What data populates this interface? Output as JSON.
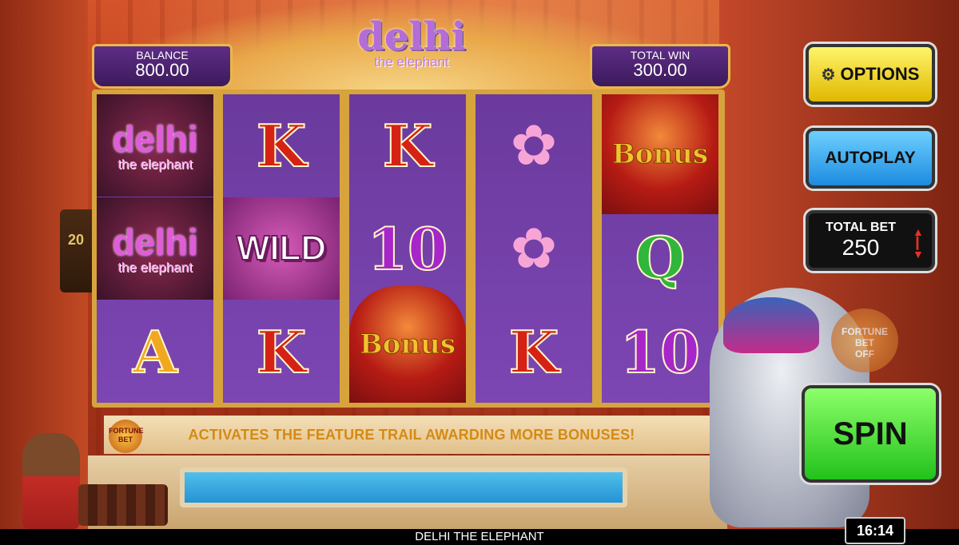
{
  "meters": {
    "balance": {
      "label": "BALANCE",
      "value": "800.00"
    },
    "total_win": {
      "label": "TOTAL WIN",
      "value": "300.00"
    }
  },
  "logo": {
    "line1": "delhi",
    "line2": "the elephant"
  },
  "reels": [
    [
      "delhi",
      "delhi",
      "A"
    ],
    [
      "K",
      "WILD",
      "K"
    ],
    [
      "K",
      "10",
      "Bonus"
    ],
    [
      "lotus",
      "lotus",
      "K"
    ],
    [
      "Bonus",
      "Q",
      "10"
    ]
  ],
  "symbols": {
    "delhi_line1": "delhi",
    "delhi_line2": "the elephant",
    "wild": "WILD",
    "bonus": "Bonus",
    "k": "K",
    "a": "A",
    "q": "Q",
    "ten": "10",
    "lotus_icon": "lotus-icon"
  },
  "side_panel": {
    "number": "20"
  },
  "banner": {
    "message": "ACTIVATES THE FEATURE TRAIL AWARDING MORE BONUSES!",
    "badge": "FORTUNE BET"
  },
  "fortune_side": {
    "line1": "FORTUNE",
    "line2": "BET",
    "state": "OFF"
  },
  "buttons": {
    "options": "OPTIONS",
    "autoplay": "AUTOPLAY",
    "total_bet_label": "TOTAL BET",
    "total_bet_value": "250",
    "spin": "SPIN"
  },
  "footer": {
    "title": "DELHI THE ELEPHANT",
    "clock": "16:14"
  },
  "colors": {
    "accent_gold": "#e9b84a",
    "reel_purple": "#6b3a9d",
    "spin_green": "#22c21b"
  }
}
